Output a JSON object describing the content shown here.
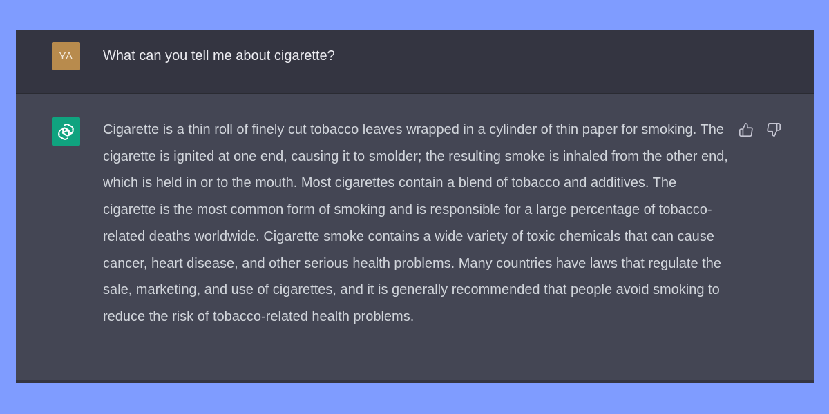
{
  "conversation": {
    "user": {
      "avatar_initials": "YA",
      "message": "What can you tell me about cigarette?"
    },
    "assistant": {
      "avatar_icon": "openai-logo-icon",
      "message": "Cigarette is a thin roll of finely cut tobacco leaves wrapped in a cylinder of thin paper for smoking. The cigarette is ignited at one end, causing it to smolder; the resulting smoke is inhaled from the other end, which is held in or to the mouth. Most cigarettes contain a blend of tobacco and additives. The cigarette is the most common form of smoking and is responsible for a large percentage of tobacco-related deaths worldwide. Cigarette smoke contains a wide variety of toxic chemicals that can cause cancer, heart disease, and other serious health problems. Many countries have laws that regulate the sale, marketing, and use of cigarettes, and it is generally recommended that people avoid smoking to reduce the risk of tobacco-related health problems.",
      "actions": [
        {
          "icon": "thumbs-up-icon"
        },
        {
          "icon": "thumbs-down-icon"
        }
      ]
    }
  },
  "colors": {
    "page_background": "#7f9cff",
    "user_row_background": "#343541",
    "assistant_row_background": "#444654",
    "user_avatar": "#b88b4d",
    "assistant_avatar": "#10a37f",
    "user_text": "#ececf1",
    "assistant_text": "#d1d5db",
    "icon_gray": "#c5c5d2"
  }
}
